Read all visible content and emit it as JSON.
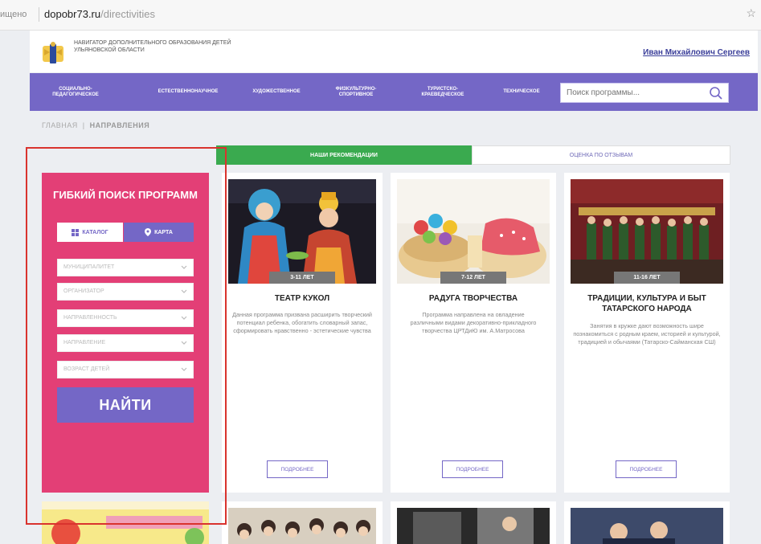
{
  "browser": {
    "prefix": "ищено",
    "url_domain": "dopobr73.ru",
    "url_path": "/directivities"
  },
  "header": {
    "brand": "НАВИГАТОР ДОПОЛНИТЕЛЬНОГО ОБРАЗОВАНИЯ ДЕТЕЙ УЛЬЯНОВСКОЙ ОБЛАСТИ",
    "user_name": "Иван Михайлович Сергеев"
  },
  "nav": {
    "items": [
      {
        "label": "СОЦИАЛЬНО-ПЕДАГОГИЧЕСКОЕ"
      },
      {
        "label": "ЕСТЕСТВЕННОНАУЧНОЕ"
      },
      {
        "label": "ХУДОЖЕСТВЕННОЕ"
      },
      {
        "label": "ФИЗКУЛЬТУРНО-СПОРТИВНОЕ"
      },
      {
        "label": "ТУРИСТСКО-КРАЕВЕДЧЕСКОЕ"
      },
      {
        "label": "ТЕХНИЧЕСКОЕ"
      }
    ],
    "search_placeholder": "Поиск программы..."
  },
  "breadcrumb": {
    "home": "ГЛАВНАЯ",
    "separator": "|",
    "current": "НАПРАВЛЕНИЯ"
  },
  "tabs": {
    "recommendations": "НАШИ РЕКОМЕНДАЦИИ",
    "reviews": "ОЦЕНКА ПО ОТЗЫВАМ"
  },
  "filter": {
    "title": "ГИБКИЙ ПОИСК ПРОГРАММ",
    "catalog_label": "КАТАЛОГ",
    "map_label": "КАРТА",
    "selects": [
      {
        "placeholder": "МУНИЦИПАЛИТЕТ"
      },
      {
        "placeholder": "ОРГАНИЗАТОР"
      },
      {
        "placeholder": "НАПРАВЛЕННОСТЬ"
      },
      {
        "placeholder": "НАПРАВЛЕНИЕ"
      },
      {
        "placeholder": "ВОЗРАСТ ДЕТЕЙ"
      }
    ],
    "find_label": "НАЙТИ"
  },
  "cards": [
    {
      "age": "3-11 ЛЕТ",
      "title": "ТЕАТР КУКОЛ",
      "description": "Данная программа призвана расширить творческий потенциал ребенка, обогатить словарный запас, сформировать нравственно - эстетические чувства",
      "more": "ПОДРОБНЕЕ"
    },
    {
      "age": "7-12 ЛЕТ",
      "title": "РАДУГА ТВОРЧЕСТВА",
      "description": "Программа направлена на овладение различными видами декоративно-прикладного творчества ЦРТДиЮ им. А.Матросова",
      "more": "ПОДРОБНЕЕ"
    },
    {
      "age": "11-16 ЛЕТ",
      "title": "ТРАДИЦИИ, КУЛЬТУРА И БЫТ ТАТАРСКОГО НАРОДА",
      "description": "Занятия в кружке дают возможность шире познакомиться с родным краем, историей и культурой, традицией и обычаями (Татарско-Сайманская СШ)",
      "more": "ПОДРОБНЕЕ"
    }
  ],
  "colors": {
    "nav": "#7467c6",
    "filter_panel": "#e33f76",
    "tab_active": "#3aaa4f",
    "highlight": "#d9332e"
  }
}
